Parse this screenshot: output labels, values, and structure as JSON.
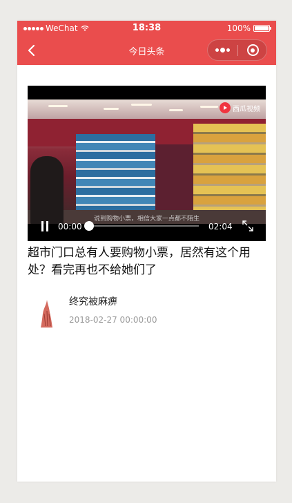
{
  "status_bar": {
    "carrier": "WeChat",
    "time": "18:38",
    "battery": "100%",
    "battery_level": 1.0
  },
  "nav": {
    "title": "今日头条"
  },
  "video": {
    "brand": "西瓜视频",
    "subtitle": "说到购物小票，相信大家一点都不陌生",
    "current_time": "00:00",
    "duration": "02:04",
    "progress": 0
  },
  "article": {
    "title": "超市门口总有人要购物小票，居然有这个用处？看完再也不给她们了",
    "author": "终究被麻痹",
    "date": "2018-02-27 00:00:00"
  },
  "colors": {
    "accent": "#ea4d4d",
    "page_bg": "#ecebe8",
    "brand_red": "#f0353f"
  },
  "icons": [
    "signal-dots-icon",
    "wifi-icon",
    "battery-icon",
    "back-arrow-icon",
    "more-dots-icon",
    "close-ring-icon",
    "play-logo-icon",
    "pause-icon",
    "fullscreen-icon"
  ]
}
